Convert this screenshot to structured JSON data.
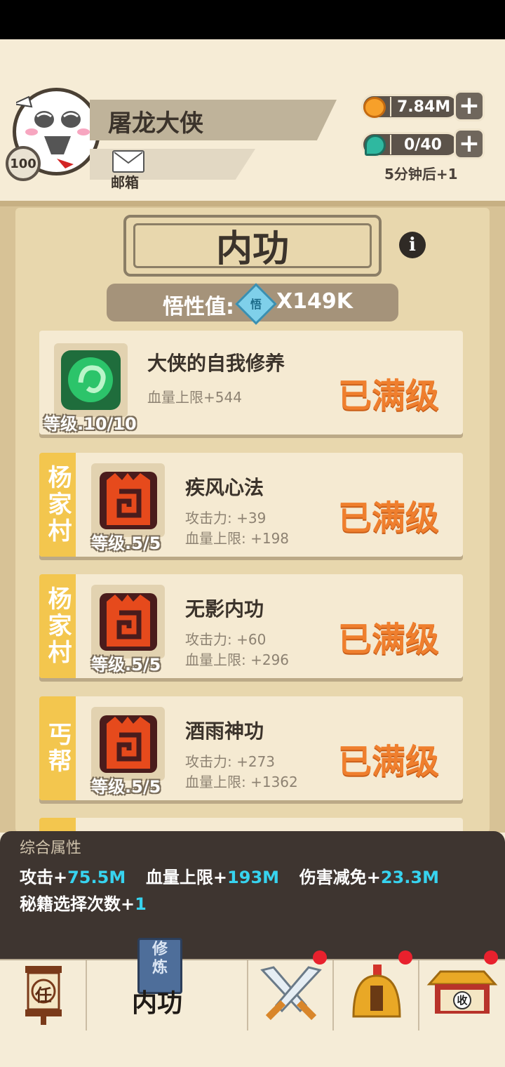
{
  "player": {
    "name": "屠龙大侠",
    "level": "100",
    "mail_label": "邮箱"
  },
  "resources": {
    "coins": "7.84M",
    "stamina": "0/40",
    "regen_text": "5分钟后+1"
  },
  "page": {
    "title": "内功",
    "insight_label": "悟性值:",
    "insight_gem": "悟",
    "insight_value": "X149K"
  },
  "skills": [
    {
      "side": "",
      "name": "大侠的自我修养",
      "stats": [
        "血量上限+544"
      ],
      "level": "等级.10/10",
      "status": "已满级",
      "icon": "green-swirl-icon"
    },
    {
      "side": "杨家村",
      "name": "疾风心法",
      "stats": [
        "攻击力: +39",
        "血量上限: +198"
      ],
      "level": "等级.5/5",
      "status": "已满级",
      "icon": "red-rune-icon"
    },
    {
      "side": "杨家村",
      "name": "无影内功",
      "stats": [
        "攻击力: +60",
        "血量上限: +296"
      ],
      "level": "等级.5/5",
      "status": "已满级",
      "icon": "red-rune-icon"
    },
    {
      "side": "丐帮",
      "name": "酒雨神功",
      "stats": [
        "攻击力: +273",
        "血量上限: +1362"
      ],
      "level": "等级.5/5",
      "status": "已满级",
      "icon": "red-rune-icon"
    }
  ],
  "summary": {
    "title": "综合属性",
    "attack_label": "攻击+",
    "attack_value": "75.5M",
    "hp_label": "血量上限+",
    "hp_value": "193M",
    "dmg_label": "伤害减免+",
    "dmg_value": "23.3M",
    "secret_label": "秘籍选择次数+",
    "secret_value": "1"
  },
  "nav": {
    "tab1_icon_text": "任",
    "tab2_book_text": "修炼",
    "tab2_label": "内功",
    "tab5_icon_text": "收"
  }
}
